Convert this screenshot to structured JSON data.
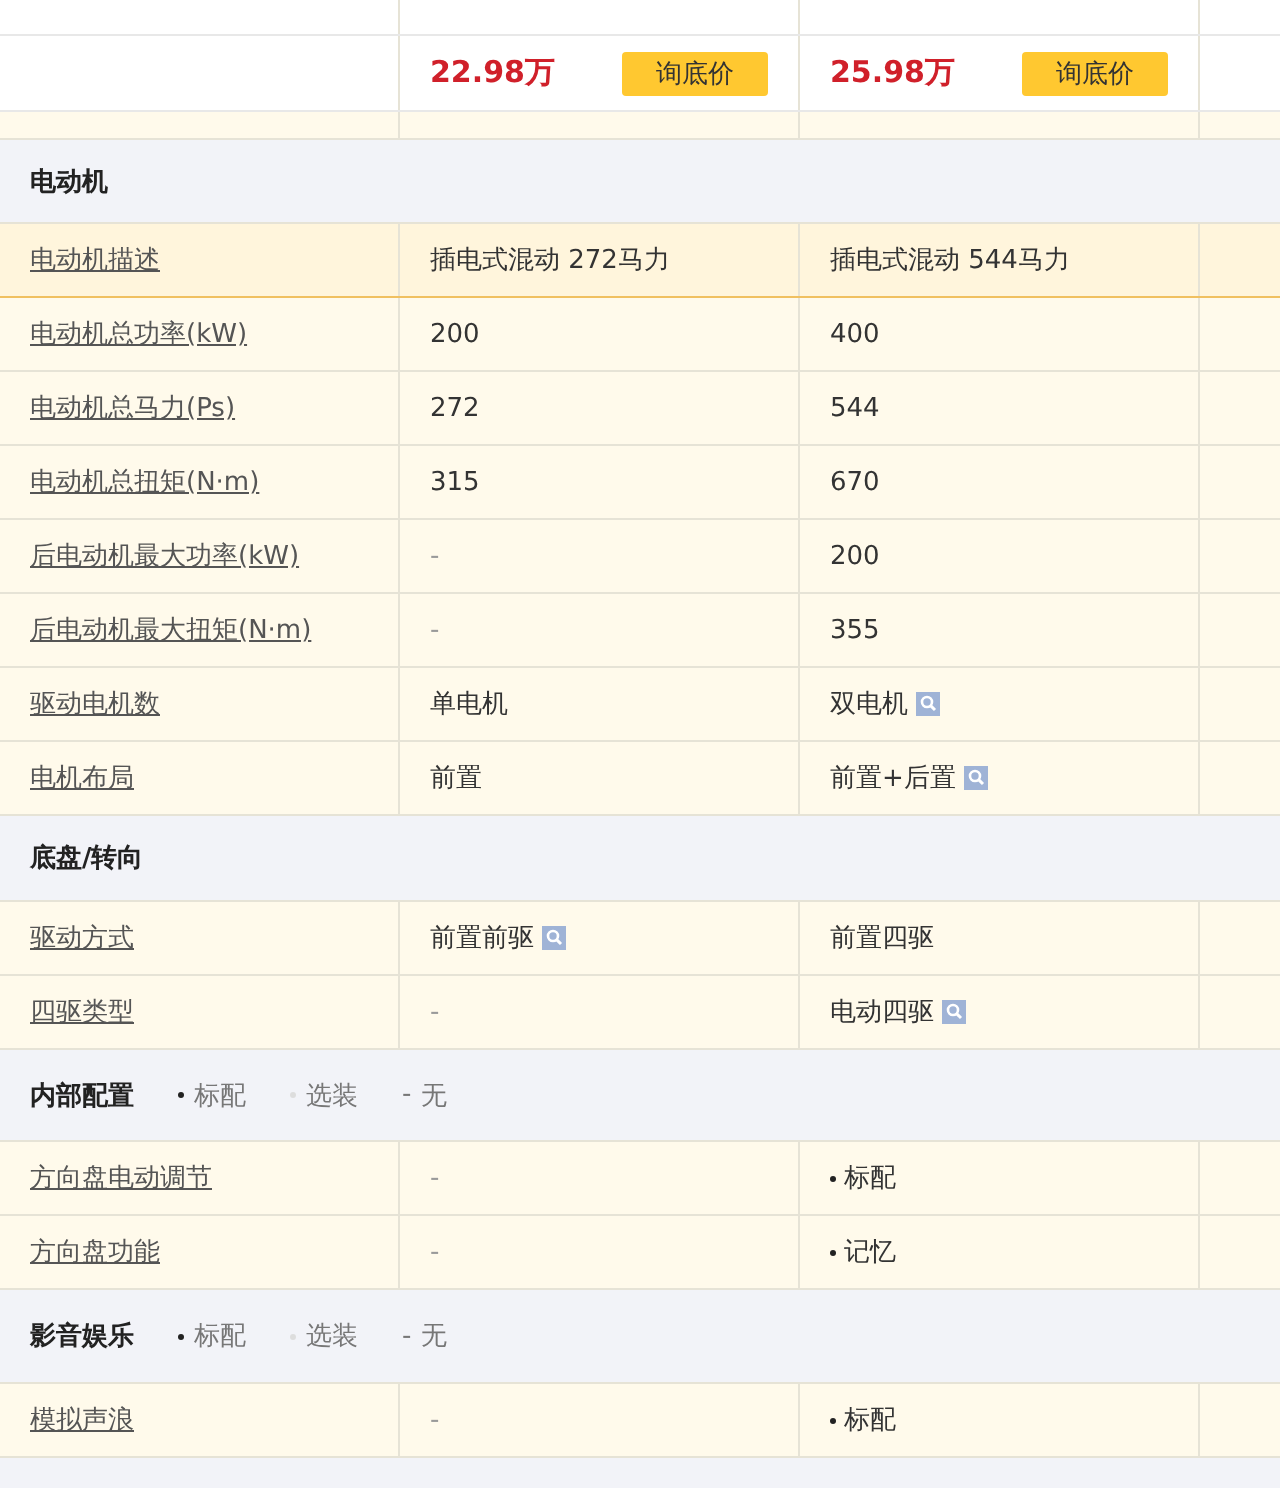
{
  "prices": [
    {
      "price": "22.98万",
      "button": "询底价"
    },
    {
      "price": "25.98万",
      "button": "询底价"
    }
  ],
  "groups": [
    {
      "title": "电动机",
      "rows": [
        {
          "label": "电动机描述",
          "highlighted": true,
          "values": [
            {
              "text": "插电式混动 272马力"
            },
            {
              "text": "插电式混动 544马力"
            }
          ]
        },
        {
          "label": "电动机总功率(kW)",
          "highlighted": false,
          "values": [
            {
              "text": "200"
            },
            {
              "text": "400"
            }
          ]
        },
        {
          "label": "电动机总马力(Ps)",
          "highlighted": false,
          "values": [
            {
              "text": "272"
            },
            {
              "text": "544"
            }
          ]
        },
        {
          "label": "电动机总扭矩(N·m)",
          "highlighted": false,
          "values": [
            {
              "text": "315"
            },
            {
              "text": "670"
            }
          ]
        },
        {
          "label": "后电动机最大功率(kW)",
          "highlighted": false,
          "values": [
            {
              "text": "-",
              "kind": "none"
            },
            {
              "text": "200"
            }
          ]
        },
        {
          "label": "后电动机最大扭矩(N·m)",
          "highlighted": false,
          "values": [
            {
              "text": "-",
              "kind": "none"
            },
            {
              "text": "355"
            }
          ]
        },
        {
          "label": "驱动电机数",
          "highlighted": false,
          "values": [
            {
              "text": "单电机"
            },
            {
              "text": "双电机",
              "lookup": true
            }
          ]
        },
        {
          "label": "电机布局",
          "highlighted": false,
          "values": [
            {
              "text": "前置"
            },
            {
              "text": "前置+后置",
              "lookup": true
            }
          ]
        }
      ]
    },
    {
      "title": "底盘/转向",
      "rows": [
        {
          "label": "驱动方式",
          "highlighted": false,
          "values": [
            {
              "text": "前置前驱",
              "lookup": true
            },
            {
              "text": "前置四驱"
            }
          ]
        },
        {
          "label": "四驱类型",
          "highlighted": false,
          "values": [
            {
              "text": "-",
              "kind": "none"
            },
            {
              "text": "电动四驱",
              "lookup": true
            }
          ]
        }
      ]
    },
    {
      "title": "内部配置",
      "legend": [
        {
          "kind": "standard",
          "label": "标配"
        },
        {
          "kind": "optional",
          "label": "选装"
        },
        {
          "kind": "none",
          "symbol": "-",
          "label": "无"
        }
      ],
      "rows": [
        {
          "label": "方向盘电动调节",
          "highlighted": false,
          "values": [
            {
              "text": "-",
              "kind": "none"
            },
            {
              "text": "标配",
              "kind": "standard"
            }
          ]
        },
        {
          "label": "方向盘功能",
          "highlighted": false,
          "values": [
            {
              "text": "-",
              "kind": "none"
            },
            {
              "text": "记忆",
              "kind": "standard"
            }
          ]
        }
      ]
    },
    {
      "title": "影音娱乐",
      "legend": [
        {
          "kind": "standard",
          "label": "标配"
        },
        {
          "kind": "optional",
          "label": "选装"
        },
        {
          "kind": "none",
          "symbol": "-",
          "label": "无"
        }
      ],
      "rows": [
        {
          "label": "模拟声浪",
          "highlighted": false,
          "values": [
            {
              "text": "-",
              "kind": "none"
            },
            {
              "text": "标配",
              "kind": "standard"
            }
          ]
        }
      ]
    }
  ]
}
